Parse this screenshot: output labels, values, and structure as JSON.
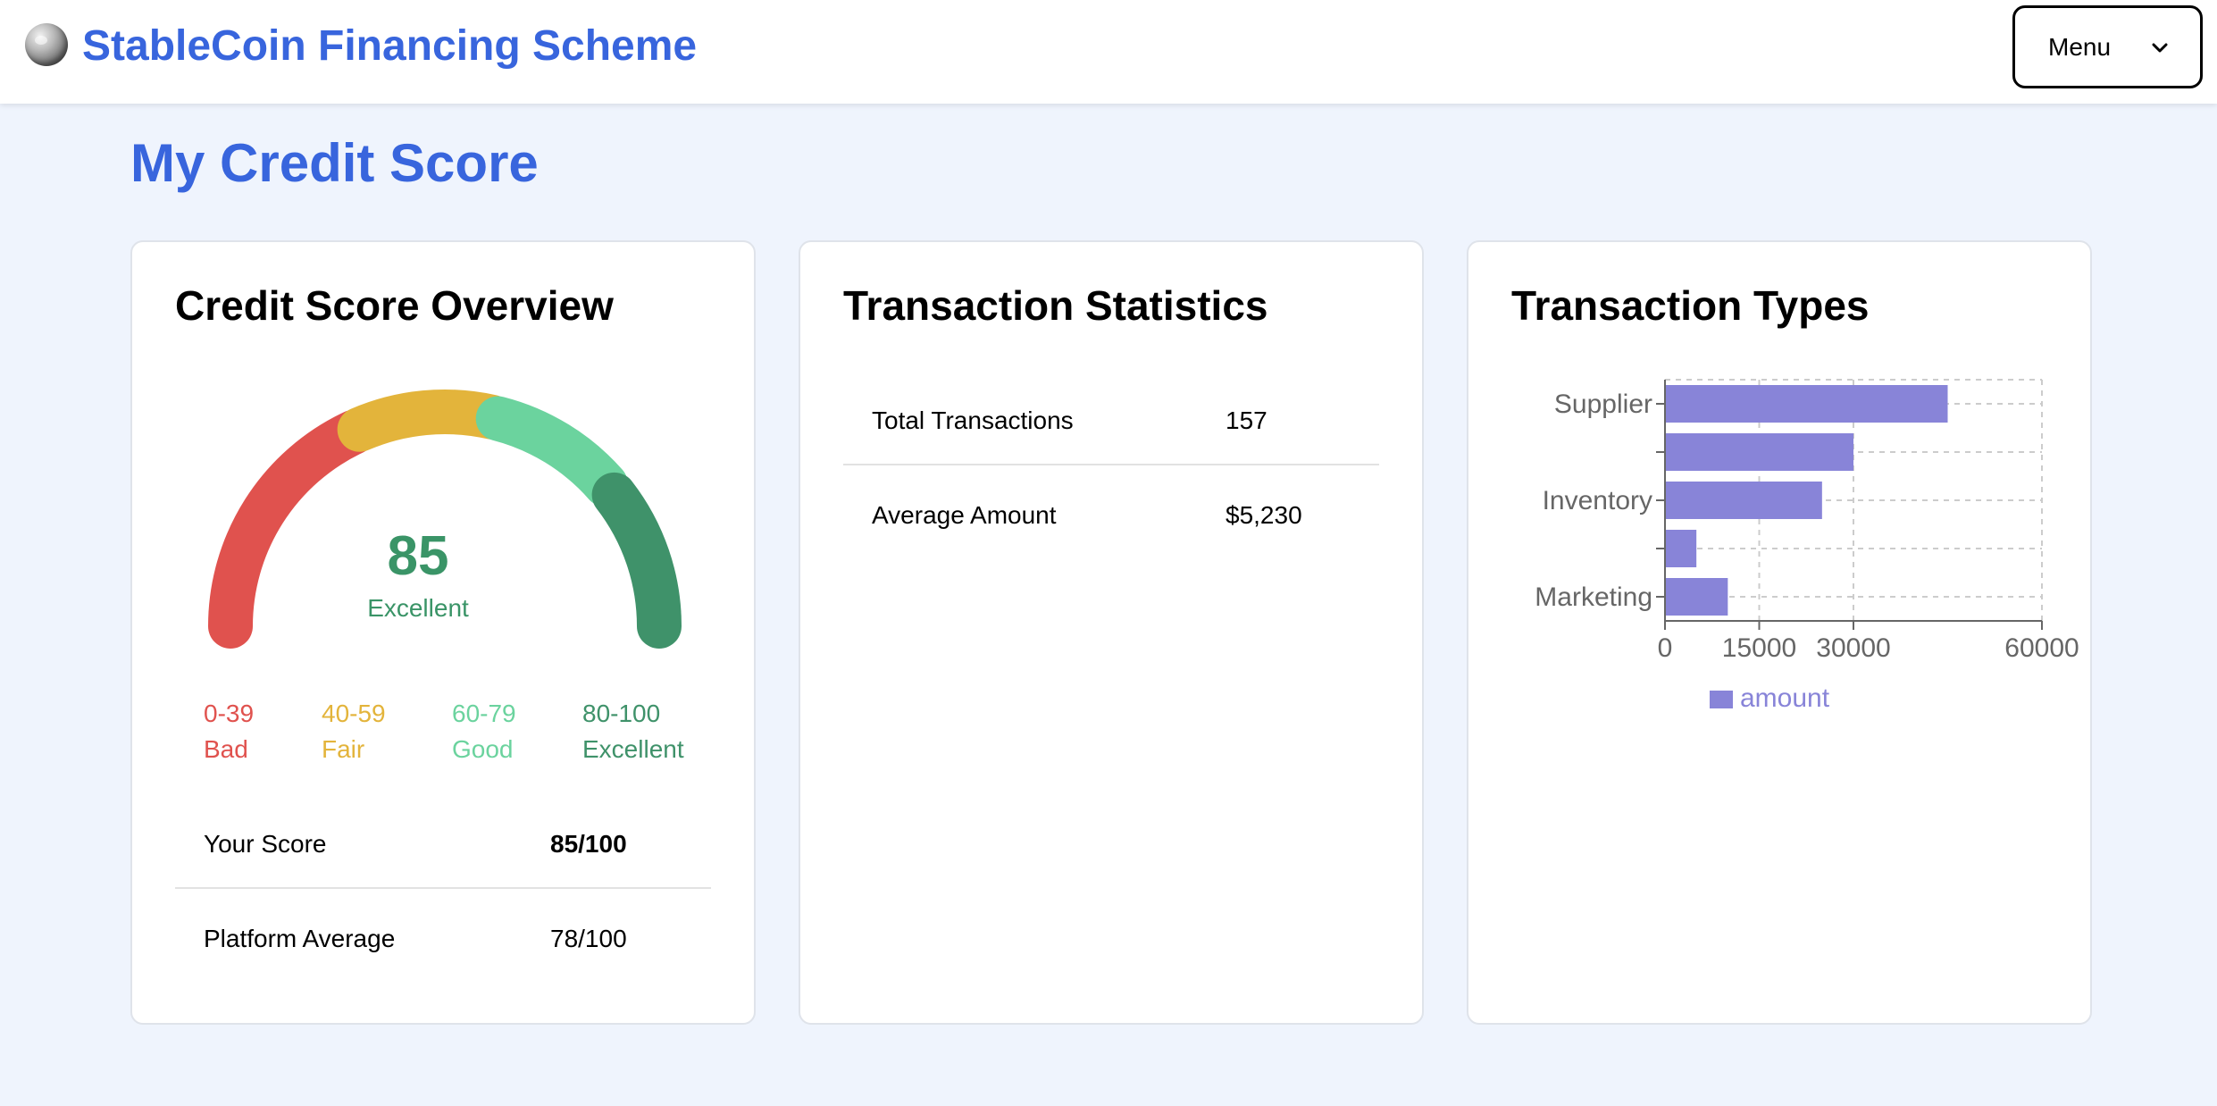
{
  "header": {
    "app_title": "StableCoin Financing Scheme",
    "menu_label": "Menu"
  },
  "page": {
    "title": "My Credit Score"
  },
  "credit_overview": {
    "title": "Credit Score Overview",
    "score": "85",
    "rating": "Excellent",
    "gauge_max": 100,
    "colors": {
      "bad": "#e0524e",
      "fair": "#e3b43b",
      "good": "#6bd39e",
      "excellent": "#3f926a"
    },
    "legend": [
      {
        "range": "0-39",
        "label": "Bad",
        "color": "#e0524e"
      },
      {
        "range": "40-59",
        "label": "Fair",
        "color": "#e3b43b"
      },
      {
        "range": "60-79",
        "label": "Good",
        "color": "#6bd39e"
      },
      {
        "range": "80-100",
        "label": "Excellent",
        "color": "#3f926a"
      }
    ],
    "your_score_label": "Your Score",
    "your_score_value": "85/100",
    "platform_avg_label": "Platform Average",
    "platform_avg_value": "78/100"
  },
  "transaction_stats": {
    "title": "Transaction Statistics",
    "rows": [
      {
        "label": "Total Transactions",
        "value": "157"
      },
      {
        "label": "Average Amount",
        "value": "$5,230"
      }
    ]
  },
  "transaction_types": {
    "title": "Transaction Types",
    "chart_data": {
      "type": "bar",
      "orientation": "horizontal",
      "categories": [
        "Supplier",
        "",
        "Inventory",
        "",
        "Marketing"
      ],
      "series": [
        {
          "name": "amount",
          "values": [
            45000,
            30000,
            25000,
            5000,
            10000
          ]
        }
      ],
      "xlim": [
        0,
        60000
      ],
      "xticks": [
        "0",
        "15000",
        "30000",
        "60000"
      ],
      "xtick_values": [
        0,
        15000,
        30000,
        60000
      ],
      "grid": true,
      "legend": "bottom-left",
      "bar_color": "#8884d8"
    }
  }
}
